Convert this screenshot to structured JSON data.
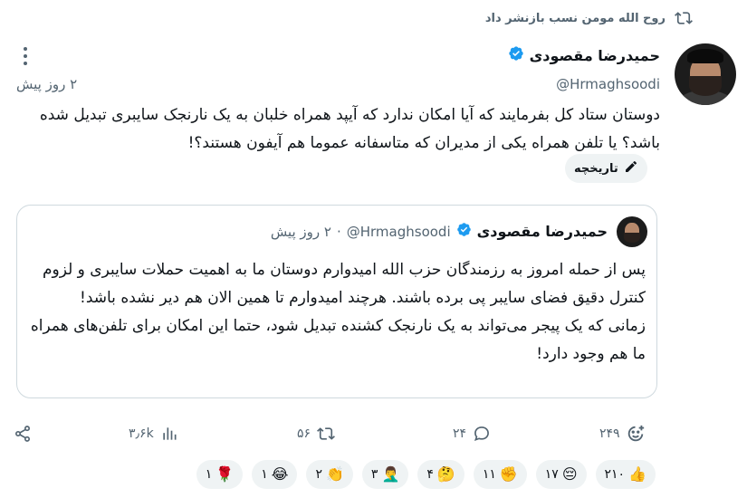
{
  "repost": {
    "label": "روح الله مومن نسب بازنشر داد",
    "icon": "repost-icon"
  },
  "tweet": {
    "author_name": "حمیدرضا مقصودی",
    "handle": "@Hrmaghsoodi",
    "time_ago": "۲ روز پیش",
    "verified": true,
    "more_icon": "more-icon",
    "text": "دوستان ستاد کل بفرمایند که آیا امکان ندارد که آیپد همراه خلبان به یک نارنجک سایبری تبدیل شده باشد؟ یا تلفن همراه یکی از مدیران که متاسفانه عموما هم آیفون هستند؟!",
    "history_label": "تاریخچه"
  },
  "quote": {
    "author_name": "حمیدرضا مقصودی",
    "handle": "@Hrmaghsoodi",
    "dot": "·",
    "time_ago": "۲ روز پیش",
    "text_line1": "پس از حمله امروز به رزمندگان حزب الله امیدوارم دوستان ما به اهمیت حملات سایبری و لزوم کنترل دقیق فضای سایبر پی برده باشند. هرچند امیدوارم تا همین الان هم دیر نشده باشد!",
    "text_line2": "زمانی که یک پیجر می‌تواند به یک نارنجک کشنده تبدیل شود، حتما این امکان برای تلفن‌های همراه ما هم وجود دارد!"
  },
  "actions": {
    "share_icon": "share-icon",
    "views": "۳٫۶k",
    "reposts": "۵۶",
    "replies": "۲۴",
    "reactions_total": "۲۴۹"
  },
  "reactions": [
    {
      "emoji": "👍",
      "count": "۲۱۰",
      "name": "thumbs-up"
    },
    {
      "emoji": "😔",
      "count": "۱۷",
      "name": "pensive"
    },
    {
      "emoji": "✊",
      "count": "۱۱",
      "name": "raised-fist"
    },
    {
      "emoji": "🤔",
      "count": "۴",
      "name": "thinking"
    },
    {
      "emoji": "🤦‍♂️",
      "count": "۳",
      "name": "facepalm"
    },
    {
      "emoji": "👏",
      "count": "۲",
      "name": "clapping"
    },
    {
      "emoji": "😂",
      "count": "۱",
      "name": "laughing"
    },
    {
      "emoji": "🌹",
      "count": "۱",
      "name": "rose"
    }
  ],
  "colors": {
    "verified_blue": "#1d9bf0",
    "muted": "#536471",
    "chip_bg": "#eff3f4"
  }
}
